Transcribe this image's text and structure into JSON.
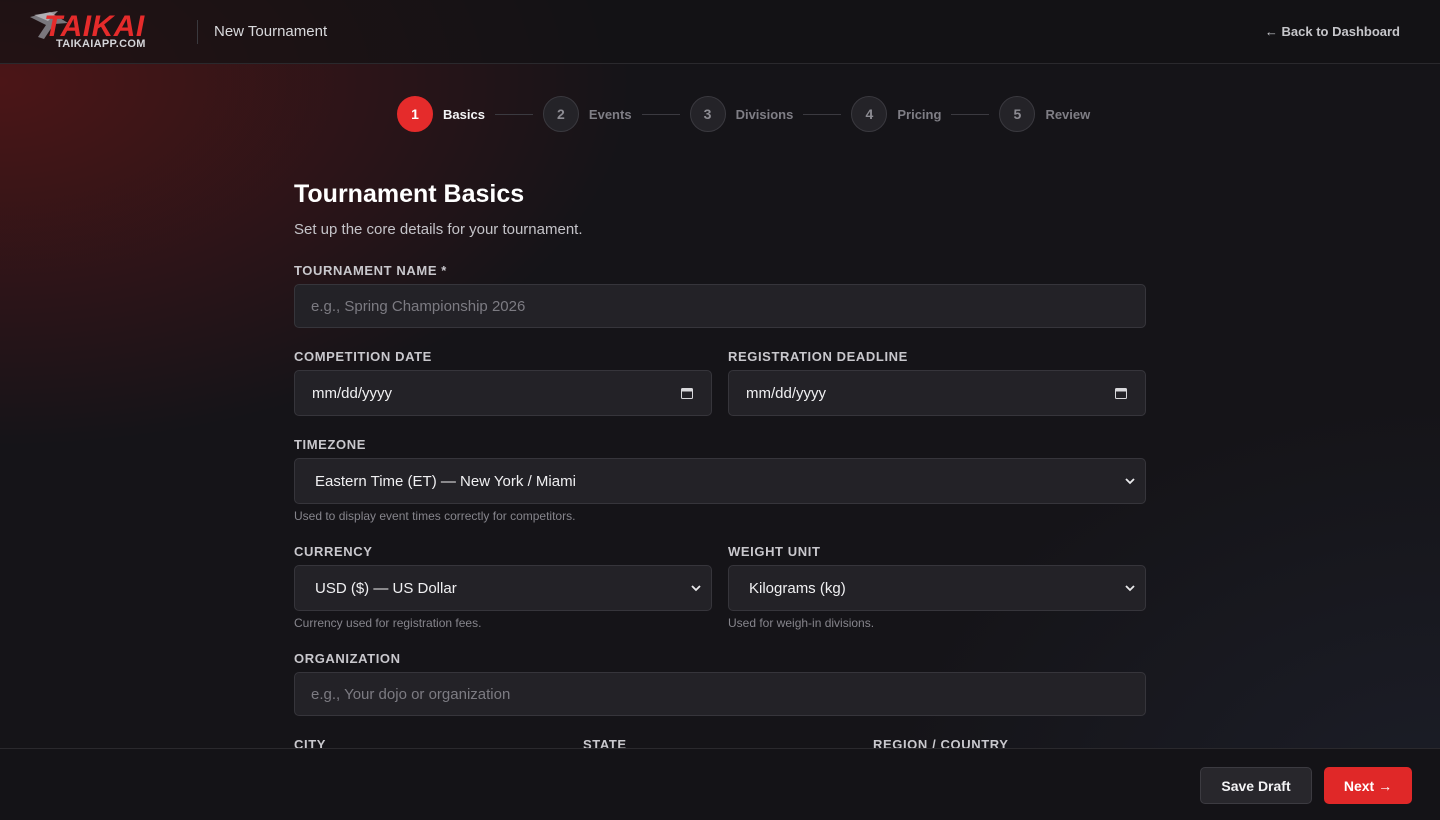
{
  "header": {
    "logo_text": "TAIKAI",
    "logo_subtext": "TAIKAIAPP.COM",
    "page_title": "New Tournament",
    "back_link": "← Back to Dashboard"
  },
  "stepper": {
    "steps": [
      {
        "number": "1",
        "label": "Basics",
        "active": true
      },
      {
        "number": "2",
        "label": "Events",
        "active": false
      },
      {
        "number": "3",
        "label": "Divisions",
        "active": false
      },
      {
        "number": "4",
        "label": "Pricing",
        "active": false
      },
      {
        "number": "5",
        "label": "Review",
        "active": false
      }
    ]
  },
  "form": {
    "title": "Tournament Basics",
    "subtitle": "Set up the core details for your tournament.",
    "tournament_name": {
      "label": "TOURNAMENT NAME *",
      "placeholder": "e.g., Spring Championship 2026"
    },
    "competition_date": {
      "label": "COMPETITION DATE",
      "value": "mm/dd/yyyy"
    },
    "registration_deadline": {
      "label": "REGISTRATION DEADLINE",
      "value": "mm/dd/yyyy"
    },
    "timezone": {
      "label": "TIMEZONE",
      "value": "Eastern Time (ET) — New York / Miami",
      "hint": "Used to display event times correctly for competitors."
    },
    "currency": {
      "label": "CURRENCY",
      "value": "USD ($) — US Dollar",
      "hint": "Currency used for registration fees."
    },
    "weight_unit": {
      "label": "WEIGHT UNIT",
      "value": "Kilograms (kg)",
      "hint": "Used for weigh-in divisions."
    },
    "organization": {
      "label": "ORGANIZATION",
      "placeholder": "e.g., Your dojo or organization"
    },
    "city": {
      "label": "CITY"
    },
    "state": {
      "label": "STATE"
    },
    "region_country": {
      "label": "REGION / COUNTRY"
    }
  },
  "footer": {
    "save_draft": "Save Draft",
    "next": "Next →"
  },
  "colors": {
    "accent": "#e52b2b",
    "background": "#151418",
    "field_bg": "#232227"
  }
}
